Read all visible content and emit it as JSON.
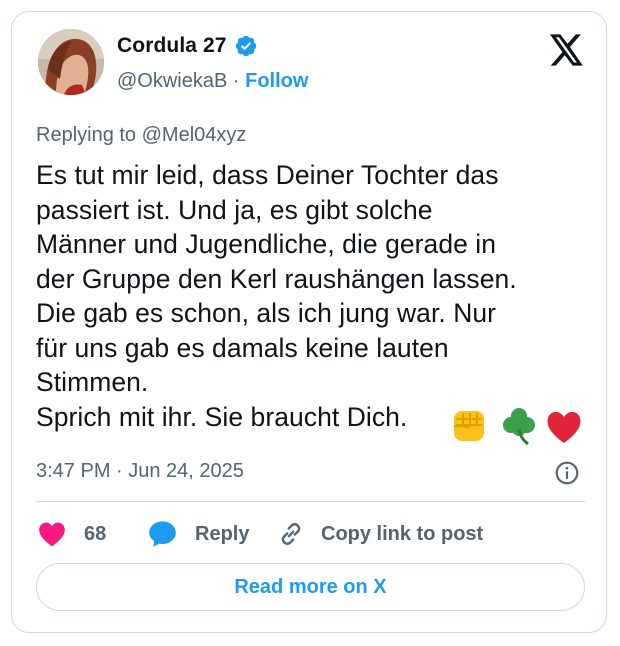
{
  "author": {
    "name": "Cordula 27",
    "handle": "@OkwiekaB",
    "separator": " · ",
    "follow_label": "Follow",
    "verified": true
  },
  "reply_context": {
    "prefix": "Replying to ",
    "handle": "@Mel04xyz"
  },
  "tweet": {
    "text": "Es tut mir leid, dass Deiner Tochter das\npassiert ist. Und ja, es gibt solche\nMänner und Jugendliche, die gerade in\nder Gruppe den Kerl raushängen lassen.\nDie gab es schon, als ich jung war. Nur\nfür uns gab es damals keine lauten\nStimmen.\nSprich mit ihr. Sie braucht Dich.",
    "emojis": [
      "raised-fist-emoji",
      "shamrock-emoji",
      "red-heart-emoji"
    ],
    "timestamp": "3:47 PM · Jun 24, 2025"
  },
  "actions": {
    "like_count": "68",
    "reply_label": "Reply",
    "copy_label": "Copy link to post"
  },
  "footer": {
    "read_more_label": "Read more on X"
  },
  "colors": {
    "accent": "#1d9bf0",
    "like": "#f91880",
    "secondary_text": "#536471",
    "border": "#cfd9de"
  }
}
